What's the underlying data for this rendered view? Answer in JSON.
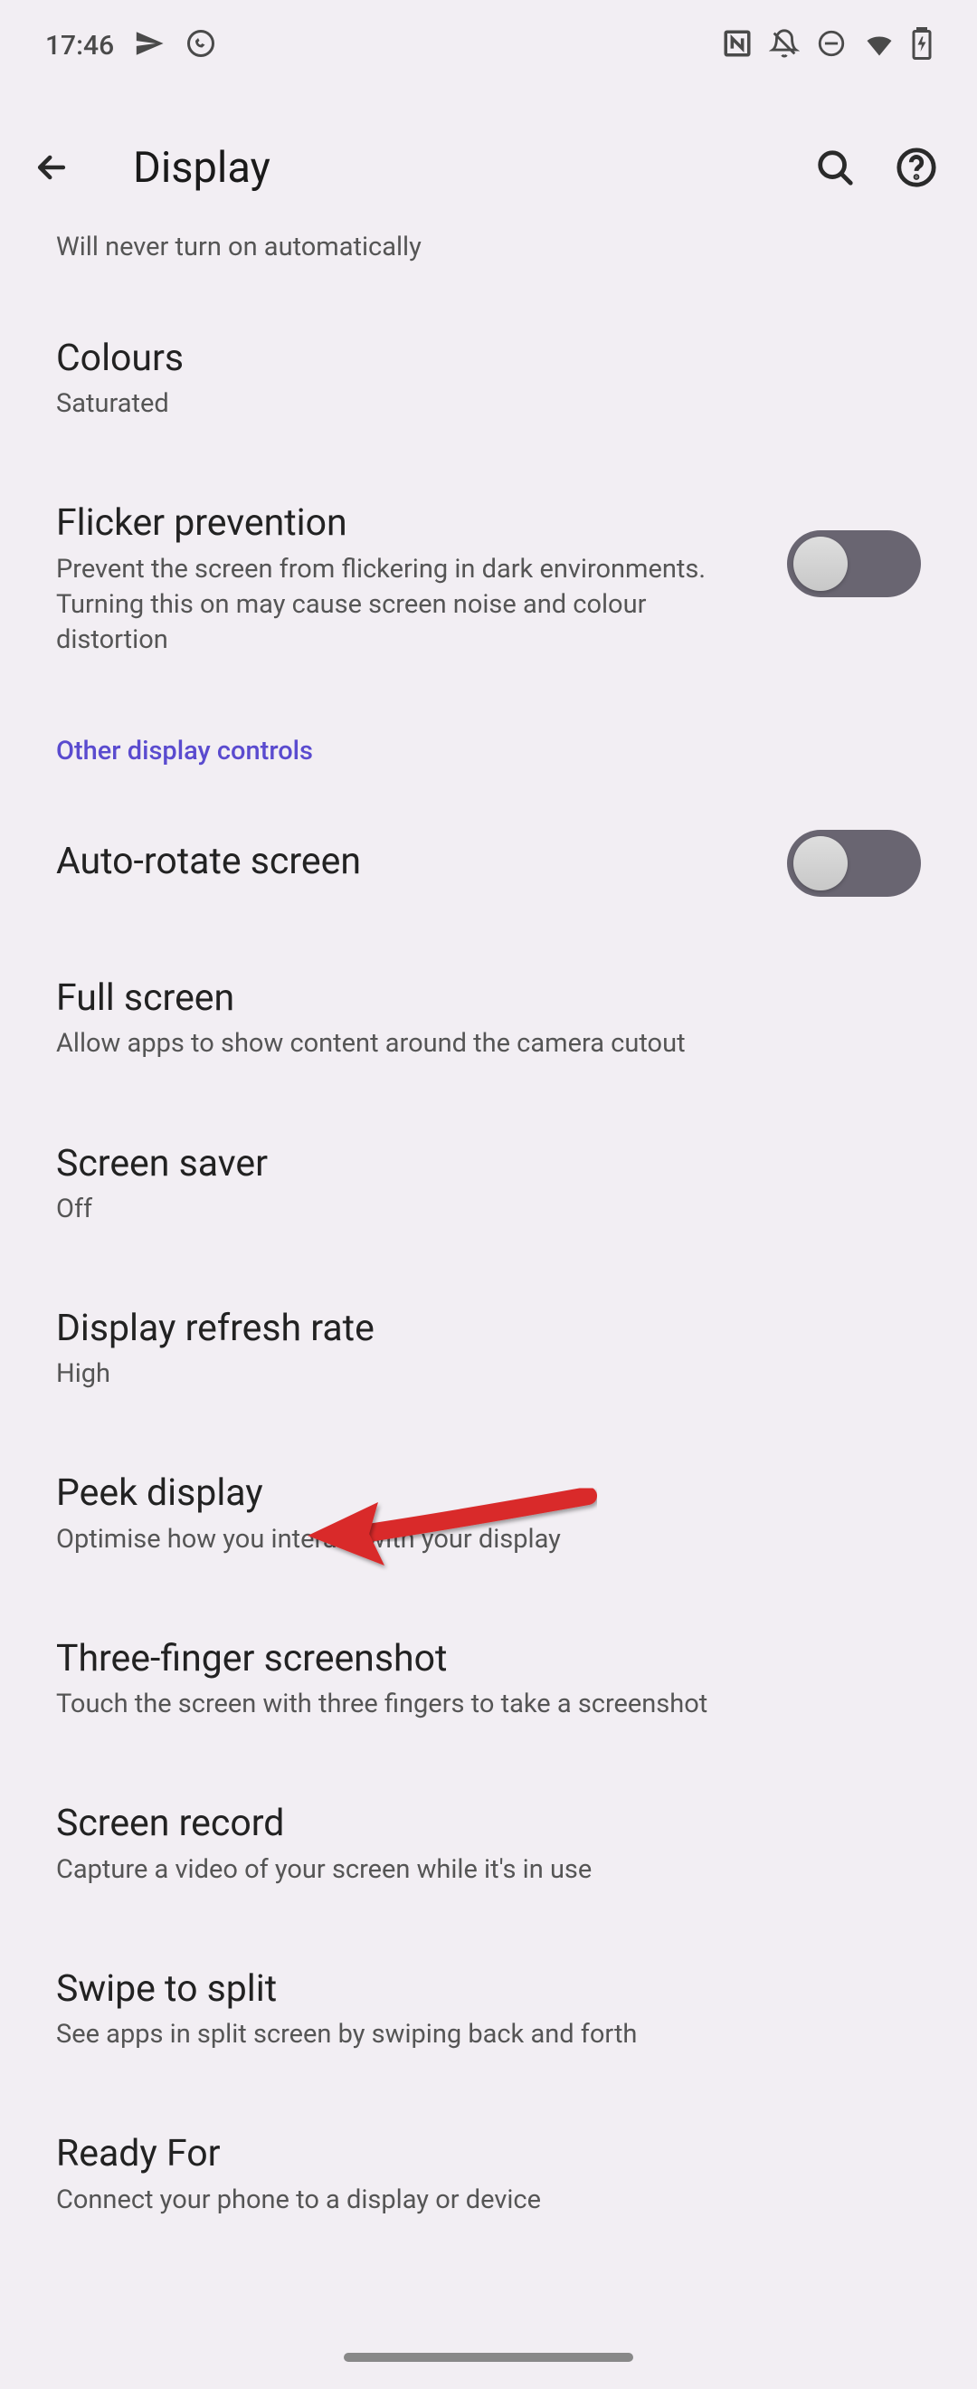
{
  "status": {
    "time": "17:46"
  },
  "header": {
    "title": "Display"
  },
  "partial": {
    "text": "Will never turn on automatically"
  },
  "settings": {
    "colours": {
      "title": "Colours",
      "subtitle": "Saturated"
    },
    "flicker": {
      "title": "Flicker prevention",
      "subtitle": "Prevent the screen from flickering in dark environments. Turning this on may cause screen noise and colour distortion"
    },
    "section1": "Other display controls",
    "autorotate": {
      "title": "Auto-rotate screen"
    },
    "fullscreen": {
      "title": "Full screen",
      "subtitle": "Allow apps to show content around the camera cutout"
    },
    "screensaver": {
      "title": "Screen saver",
      "subtitle": "Off"
    },
    "refresh": {
      "title": "Display refresh rate",
      "subtitle": "High"
    },
    "peek": {
      "title": "Peek display",
      "subtitle": "Optimise how you interact with your display"
    },
    "threefinger": {
      "title": "Three-finger screenshot",
      "subtitle": "Touch the screen with three fingers to take a screenshot"
    },
    "record": {
      "title": "Screen record",
      "subtitle": "Capture a video of your screen while it's in use"
    },
    "swipe": {
      "title": "Swipe to split",
      "subtitle": "See apps in split screen by swiping back and forth"
    },
    "readyfor": {
      "title": "Ready For",
      "subtitle": "Connect your phone to a display or device"
    }
  }
}
